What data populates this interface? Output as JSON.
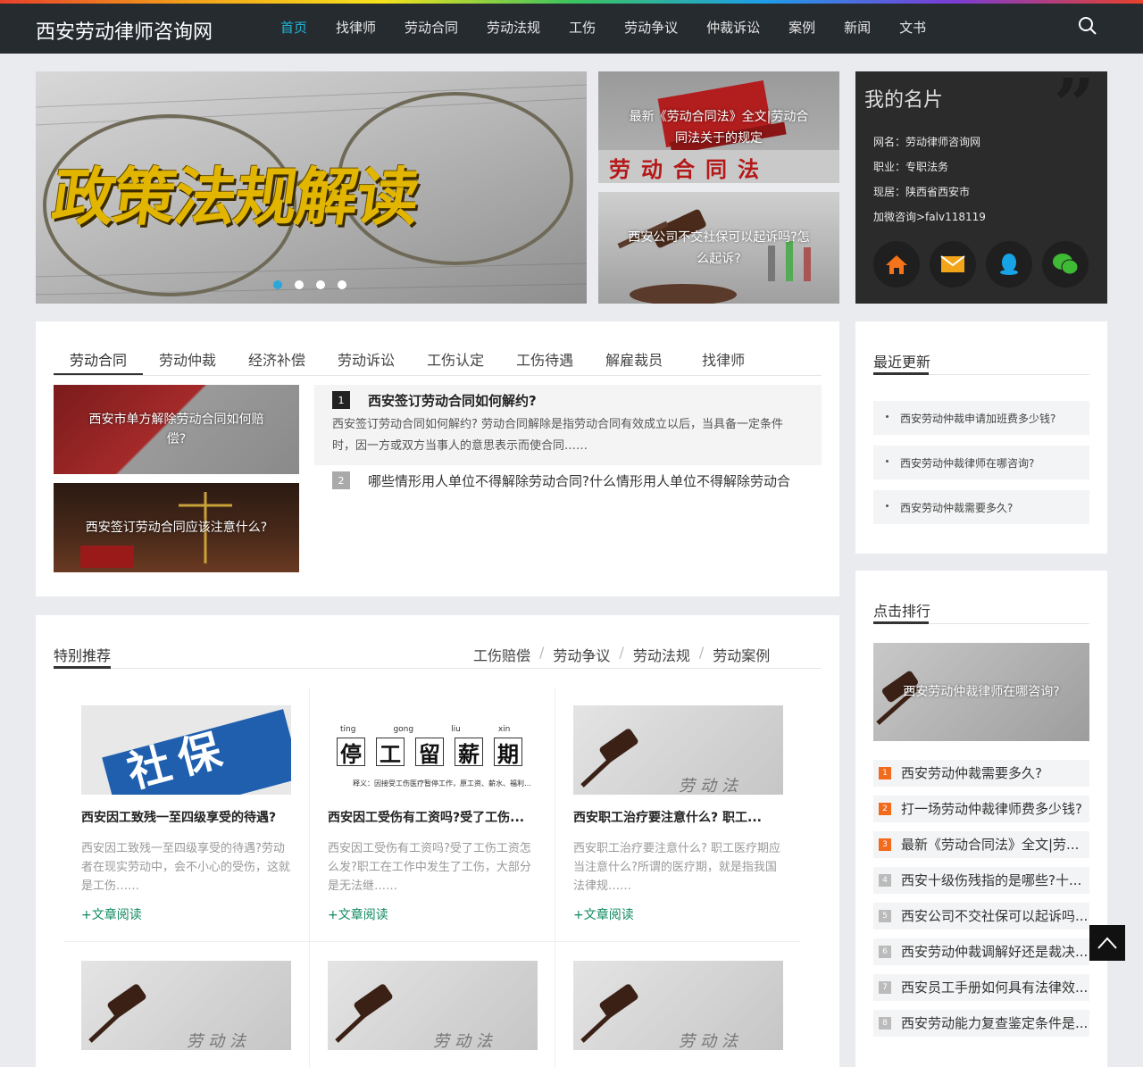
{
  "site": {
    "logo": "西安劳动律师咨询网"
  },
  "nav": [
    "首页",
    "找律师",
    "劳动合同",
    "劳动法规",
    "工伤",
    "劳动争议",
    "仲裁诉讼",
    "案例",
    "新闻",
    "文书"
  ],
  "hero": {
    "title": "政策法规解读"
  },
  "side_images": [
    {
      "caption": "最新《劳动合同法》全文|劳动合同法关于的规定",
      "overlay_text": "劳动合同法"
    },
    {
      "caption": "西安公司不交社保可以起诉吗?怎么起诉?"
    }
  ],
  "card": {
    "title": "我的名片",
    "lines": [
      "网名：劳动律师咨询网",
      "职业：专职法务",
      "现居：陕西省西安市",
      "加微咨询>falv118119"
    ]
  },
  "tabs": [
    "劳动合同",
    "劳动仲裁",
    "经济补偿",
    "劳动诉讼",
    "工伤认定",
    "工伤待遇",
    "解雇裁员",
    "找律师"
  ],
  "tab_thumbs": [
    "西安市单方解除劳动合同如何赔偿?",
    "西安签订劳动合同应该注意什么?"
  ],
  "tab_list": [
    {
      "num": "1",
      "title": "西安签订劳动合同如何解约?",
      "desc": "西安签订劳动合同如何解约? 劳动合同解除是指劳动合同有效成立以后，当具备一定条件时，因一方或双方当事人的意思表示而使合同……"
    },
    {
      "num": "2",
      "title": "哪些情形用人单位不得解除劳动合同?什么情形用人单位不得解除劳动合"
    }
  ],
  "recent": {
    "title": "最近更新",
    "items": [
      "西安劳动仲裁申请加班费多少钱?",
      "西安劳动仲裁律师在哪咨询?",
      "西安劳动仲裁需要多久?"
    ]
  },
  "ranking": {
    "title": "点击排行",
    "feature": "西安劳动仲裁律师在哪咨询?",
    "items": [
      {
        "n": "1",
        "t": "西安劳动仲裁需要多久?"
      },
      {
        "n": "2",
        "t": "打一场劳动仲裁律师费多少钱?"
      },
      {
        "n": "3",
        "t": "最新《劳动合同法》全文|劳..."
      },
      {
        "n": "4",
        "t": "西安十级伤残指的是哪些?十..."
      },
      {
        "n": "5",
        "t": "西安公司不交社保可以起诉吗..."
      },
      {
        "n": "6",
        "t": "西安劳动仲裁调解好还是裁决..."
      },
      {
        "n": "7",
        "t": "西安员工手册如何具有法律效..."
      },
      {
        "n": "8",
        "t": "西安劳动能力复查鉴定条件是..."
      }
    ],
    "colors": {
      "top": "#f26b1d",
      "rest": "#bbbbbb"
    }
  },
  "special": {
    "title": "特别推荐",
    "links": [
      "工伤赔偿",
      "劳动争议",
      "劳动法规",
      "劳动案例"
    ],
    "sep": "/",
    "items": [
      {
        "title": "西安因工致残一至四级享受的待遇?",
        "desc": "西安因工致残一至四级享受的待遇?劳动者在现实劳动中，会不小心的受伤，这就是工伤……",
        "more": "+文章阅读",
        "img_text": "社保"
      },
      {
        "title": "西安因工受伤有工资吗?受了工伤...",
        "desc": "西安因工受伤有工资吗?受了工伤工资怎么发?职工在工作中发生了工伤，大部分是无法继……",
        "more": "+文章阅读",
        "img_chars": [
          "停",
          "工",
          "留",
          "薪",
          "期"
        ],
        "img_pinyin": [
          "ting",
          "gong",
          "liu",
          "xin",
          "xin"
        ],
        "img_sub": "释义：因接受工伤医疗暂停工作，原工资、薪水、福利…保险等待遇不变的期间"
      },
      {
        "title": "西安职工治疗要注意什么? 职工...",
        "desc": "西安职工治疗要注意什么? 职工医疗期应当注意什么?所谓的医疗期，就是指我国法律规……",
        "more": "+文章阅读",
        "img_text": "劳动法"
      }
    ],
    "row2_img_text": "劳动法"
  },
  "accent": "#1fb5d6"
}
